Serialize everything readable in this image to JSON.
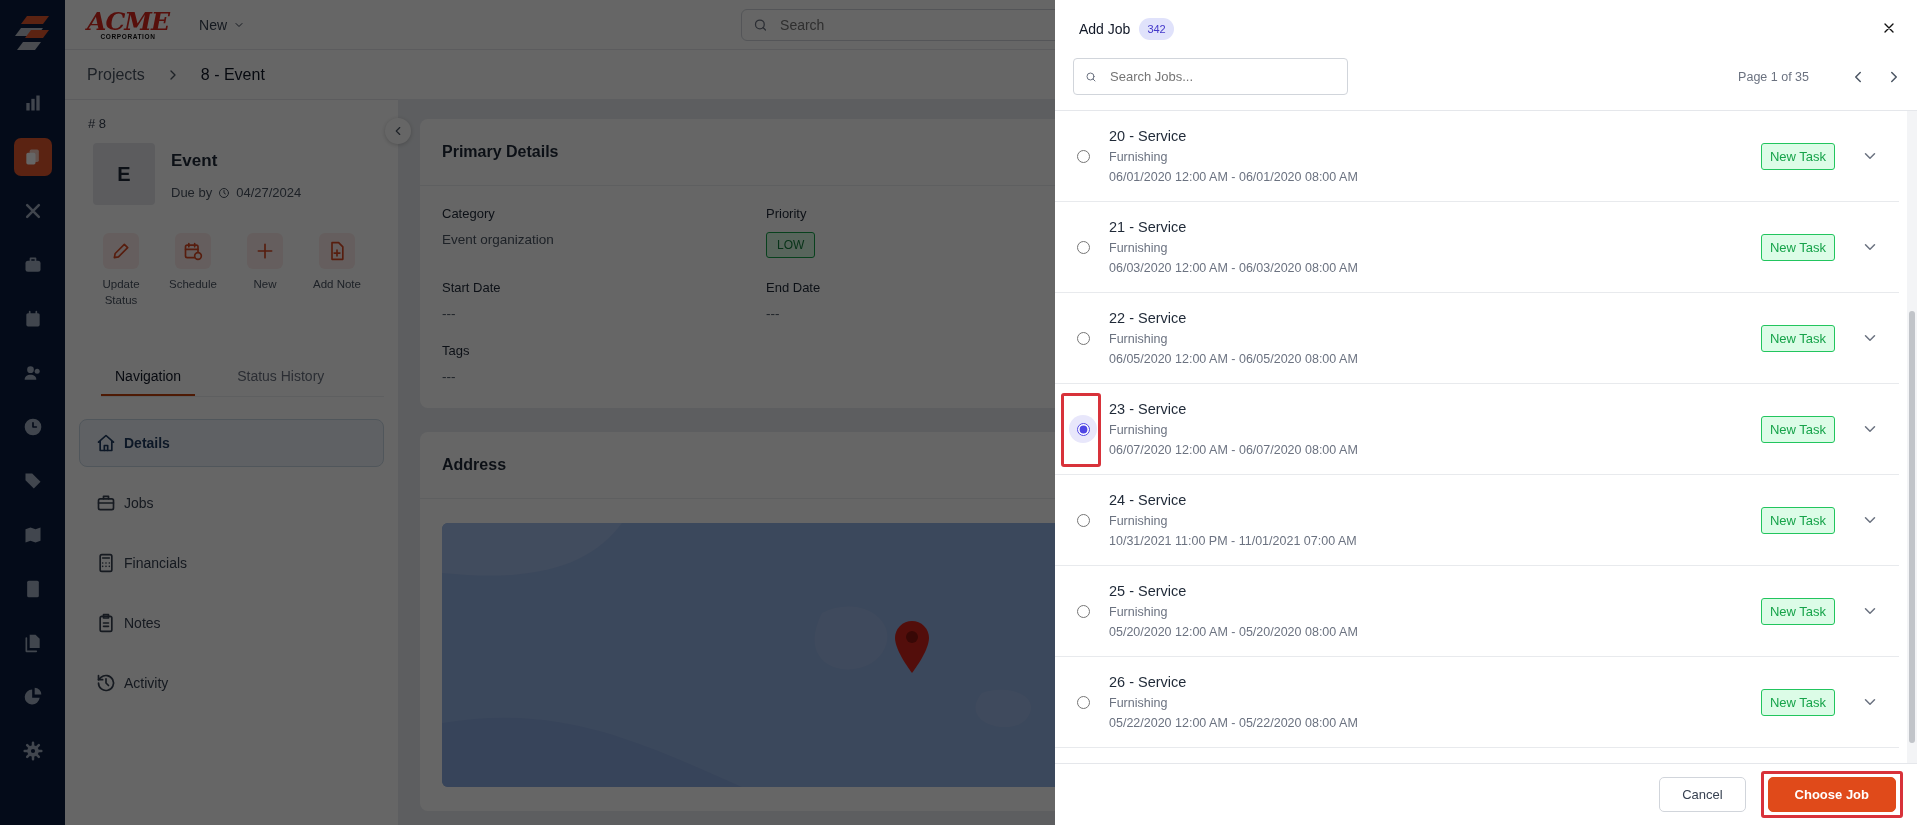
{
  "sidebar": {
    "items": [
      {
        "selected": false
      },
      {
        "selected": true
      },
      {
        "selected": false
      },
      {
        "selected": false
      },
      {
        "selected": false
      },
      {
        "selected": false
      },
      {
        "selected": false
      },
      {
        "selected": false
      },
      {
        "selected": false
      },
      {
        "selected": false
      },
      {
        "selected": false
      },
      {
        "selected": false
      },
      {
        "selected": false
      }
    ]
  },
  "header": {
    "logo": {
      "name": "ACME",
      "tagline": "CORPORATION"
    },
    "new_menu": "New",
    "search": {
      "placeholder": "Search"
    }
  },
  "breadcrumb": [
    "Projects",
    "8 - Event"
  ],
  "project": {
    "number": "# 8",
    "avatar": "E",
    "title": "Event",
    "due_label": "Due by",
    "due_date": "04/27/2024"
  },
  "actions": [
    {
      "label": "Update Status"
    },
    {
      "label": "Schedule"
    },
    {
      "label": "New"
    },
    {
      "label": "Add Note"
    }
  ],
  "tabs": [
    {
      "label": "Navigation",
      "selected": true
    },
    {
      "label": "Status History",
      "selected": false
    }
  ],
  "nav": [
    {
      "label": "Details",
      "selected": true
    },
    {
      "label": "Jobs",
      "selected": false
    },
    {
      "label": "Financials",
      "selected": false
    },
    {
      "label": "Notes",
      "selected": false
    },
    {
      "label": "Activity",
      "selected": false
    }
  ],
  "primary_details": {
    "title": "Primary Details",
    "fields": [
      {
        "label": "Category",
        "value": "Event organization",
        "kind": "text"
      },
      {
        "label": "Priority",
        "value": "LOW",
        "kind": "badge"
      },
      {
        "label": "Start Date",
        "value": "---",
        "kind": "text"
      },
      {
        "label": "End Date",
        "value": "---",
        "kind": "text"
      },
      {
        "label": "Tags",
        "value": "---",
        "kind": "text"
      }
    ]
  },
  "address": {
    "title": "Address"
  },
  "modal": {
    "title": "Add Job",
    "count": "342",
    "search": {
      "placeholder": "Search Jobs..."
    },
    "page": "Page 1 of 35",
    "jobs": [
      {
        "title": "20 - Service",
        "category": "Furnishing",
        "dates": "06/01/2020 12:00 AM - 06/01/2020 08:00 AM",
        "status": "New Task",
        "selected": false,
        "highlighted": false
      },
      {
        "title": "21 - Service",
        "category": "Furnishing",
        "dates": "06/03/2020 12:00 AM - 06/03/2020 08:00 AM",
        "status": "New Task",
        "selected": false,
        "highlighted": false
      },
      {
        "title": "22 - Service",
        "category": "Furnishing",
        "dates": "06/05/2020 12:00 AM - 06/05/2020 08:00 AM",
        "status": "New Task",
        "selected": false,
        "highlighted": false
      },
      {
        "title": "23 - Service",
        "category": "Furnishing",
        "dates": "06/07/2020 12:00 AM - 06/07/2020 08:00 AM",
        "status": "New Task",
        "selected": true,
        "highlighted": true
      },
      {
        "title": "24 - Service",
        "category": "Furnishing",
        "dates": "10/31/2021 11:00 PM - 11/01/2021 07:00 AM",
        "status": "New Task",
        "selected": false,
        "highlighted": false
      },
      {
        "title": "25 - Service",
        "category": "Furnishing",
        "dates": "05/20/2020 12:00 AM - 05/20/2020 08:00 AM",
        "status": "New Task",
        "selected": false,
        "highlighted": false
      },
      {
        "title": "26 - Service",
        "category": "Furnishing",
        "dates": "05/22/2020 12:00 AM - 05/22/2020 08:00 AM",
        "status": "New Task",
        "selected": false,
        "highlighted": false
      }
    ],
    "buttons": [
      {
        "label": "Cancel",
        "kind": "secondary",
        "highlighted": false
      },
      {
        "label": "Choose Job",
        "kind": "primary",
        "highlighted": true
      }
    ]
  }
}
